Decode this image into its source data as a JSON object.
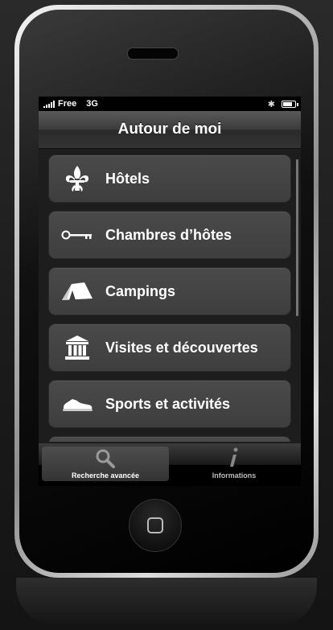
{
  "status_bar": {
    "carrier": "Free",
    "network": "3G",
    "bluetooth_icon": "bluetooth-icon",
    "battery_icon": "battery-icon",
    "battery_level": 0.8
  },
  "nav": {
    "title": "Autour de moi"
  },
  "list": {
    "items": [
      {
        "label": "Hôtels",
        "icon": "fleur-de-lis-icon"
      },
      {
        "label": "Chambres d’hôtes",
        "icon": "key-icon"
      },
      {
        "label": "Campings",
        "icon": "tent-icon"
      },
      {
        "label": "Visites et découvertes",
        "icon": "monument-icon"
      },
      {
        "label": "Sports et activités",
        "icon": "sneaker-icon"
      }
    ]
  },
  "tab_bar": {
    "tabs": [
      {
        "label": "Recherche avancée",
        "icon": "search-icon",
        "active": true
      },
      {
        "label": "Informations",
        "icon": "info-icon",
        "active": false
      }
    ]
  }
}
